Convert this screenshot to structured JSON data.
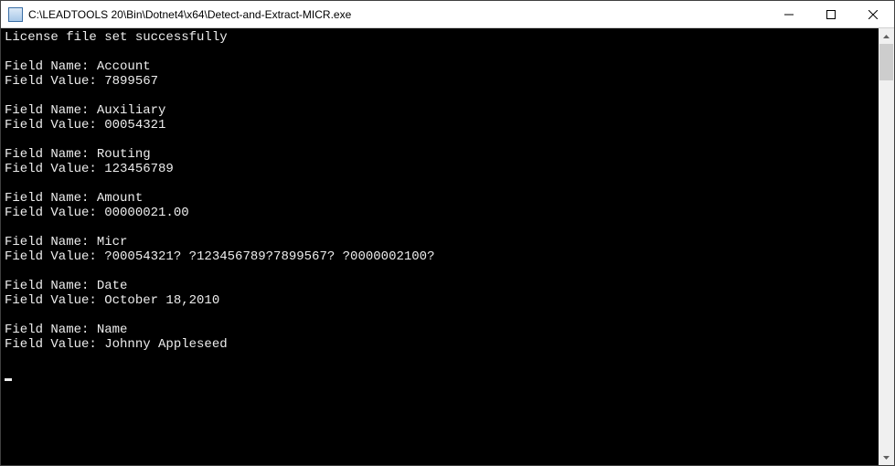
{
  "window": {
    "title": "C:\\LEADTOOLS 20\\Bin\\Dotnet4\\x64\\Detect-and-Extract-MICR.exe"
  },
  "console": {
    "status_line": "License file set successfully",
    "field_name_label": "Field Name:",
    "field_value_label": "Field Value:",
    "fields": [
      {
        "name": "Account",
        "value": "7899567"
      },
      {
        "name": "Auxiliary",
        "value": "00054321"
      },
      {
        "name": "Routing",
        "value": "123456789"
      },
      {
        "name": "Amount",
        "value": "00000021.00"
      },
      {
        "name": "Micr",
        "value": "?00054321? ?123456789?7899567? ?0000002100?"
      },
      {
        "name": "Date",
        "value": "October 18,2010"
      },
      {
        "name": "Name",
        "value": "Johnny Appleseed"
      }
    ]
  }
}
